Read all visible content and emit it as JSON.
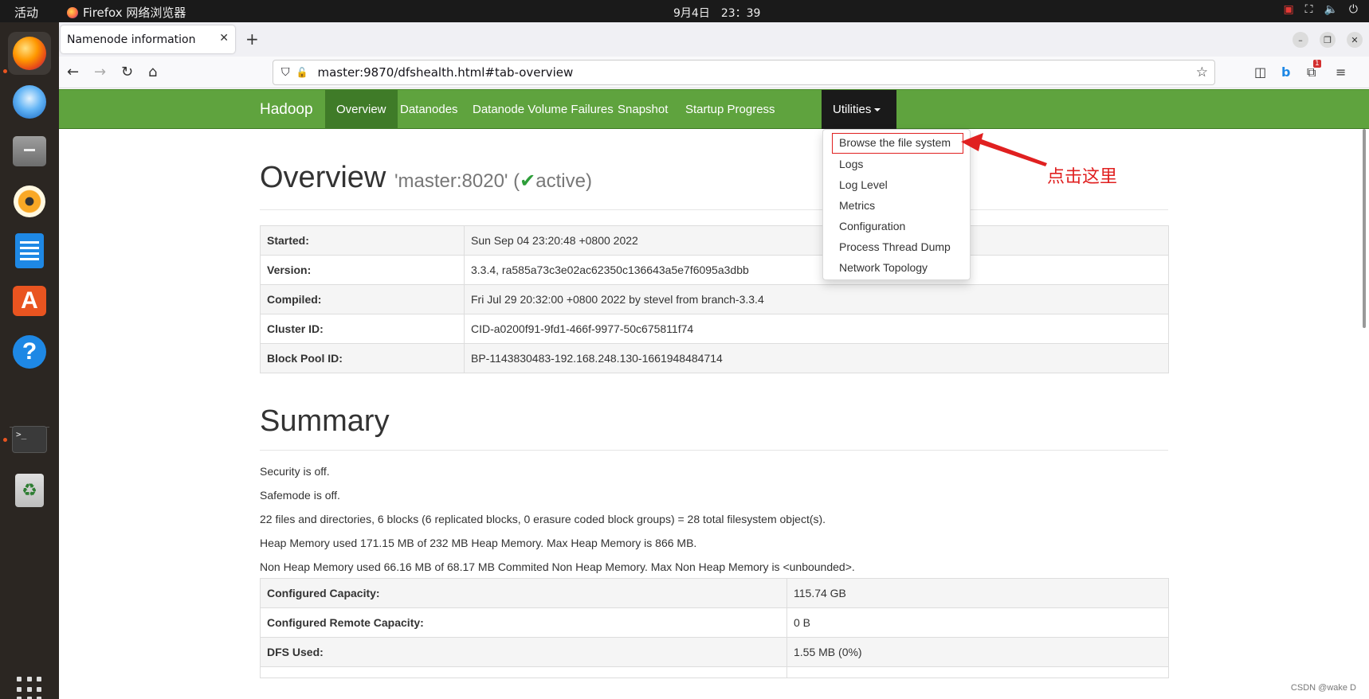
{
  "topbar": {
    "activities": "活动",
    "app_name": "Firefox 网络浏览器",
    "clock": "9月4日　23：39"
  },
  "browser": {
    "tab_title": "Namenode information",
    "url": "master:9870/dfshealth.html#tab-overview",
    "badge_count": "1"
  },
  "hadoop_nav": {
    "brand": "Hadoop",
    "items": [
      "Overview",
      "Datanodes",
      "Datanode Volume Failures",
      "Snapshot",
      "Startup Progress",
      "Utilities"
    ]
  },
  "dropdown": {
    "items": [
      "Browse the file system",
      "Logs",
      "Log Level",
      "Metrics",
      "Configuration",
      "Process Thread Dump",
      "Network Topology"
    ]
  },
  "annotation": {
    "text": "点击这里",
    "color": "#e02020"
  },
  "overview": {
    "title": "Overview",
    "host": "'master:8020' (",
    "status": "active)",
    "rows": [
      {
        "k": "Started:",
        "v": "Sun Sep 04 23:20:48 +0800 2022"
      },
      {
        "k": "Version:",
        "v": "3.3.4, ra585a73c3e02ac62350c136643a5e7f6095a3dbb"
      },
      {
        "k": "Compiled:",
        "v": "Fri Jul 29 20:32:00 +0800 2022 by stevel from branch-3.3.4"
      },
      {
        "k": "Cluster ID:",
        "v": "CID-a0200f91-9fd1-466f-9977-50c675811f74"
      },
      {
        "k": "Block Pool ID:",
        "v": "BP-1143830483-192.168.248.130-1661948484714"
      }
    ]
  },
  "summary": {
    "title": "Summary",
    "lines": [
      "Security is off.",
      "Safemode is off.",
      "22 files and directories, 6 blocks (6 replicated blocks, 0 erasure coded block groups) = 28 total filesystem object(s).",
      "Heap Memory used 171.15 MB of 232 MB Heap Memory. Max Heap Memory is 866 MB.",
      "Non Heap Memory used 66.16 MB of 68.17 MB Commited Non Heap Memory. Max Non Heap Memory is <unbounded>."
    ],
    "rows": [
      {
        "k": "Configured Capacity:",
        "v": "115.74 GB"
      },
      {
        "k": "Configured Remote Capacity:",
        "v": "0 B"
      },
      {
        "k": "DFS Used:",
        "v": "1.55 MB (0%)"
      }
    ]
  },
  "watermark": "CSDN @wake D",
  "colors": {
    "hadoop_green": "#5fa33e",
    "active_tab": "#3f7b28",
    "utilities_bg": "#1a1a1a"
  }
}
